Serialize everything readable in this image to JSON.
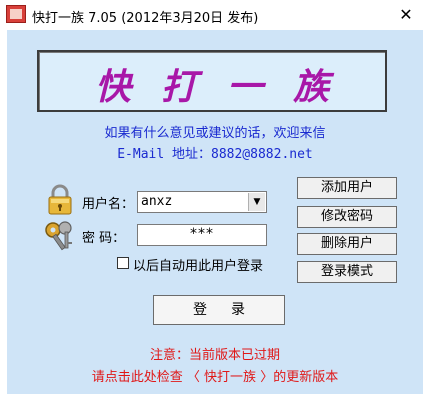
{
  "window": {
    "title": "快打一族 7.05 (2012年3月20日 发布)",
    "close_glyph": "✕"
  },
  "banner": {
    "text": "快打一族",
    "color": "#a817a8"
  },
  "info": {
    "line1": "如果有什么意见或建议的话，欢迎来信",
    "line2": "E-Mail 地址：8882@8882.net",
    "color": "#1a2ad0"
  },
  "form": {
    "username_label": "用户名：",
    "username_value": "anxz",
    "password_label": "密  码：",
    "password_value": "***",
    "auto_login_label": "以后自动用此用户登录",
    "auto_login_checked": false,
    "login_button": "登录"
  },
  "side_buttons": {
    "add_user": "添加用户",
    "change_password": "修改密码",
    "delete_user": "删除用户",
    "login_mode": "登录模式"
  },
  "notice": {
    "line1": "注意：当前版本已过期",
    "line2": "请点击此处检查 〈 快打一族 〉的更新版本",
    "color": "#e01818"
  },
  "icons": {
    "lock": "lock-icon",
    "key": "key-icon",
    "app": "app-icon"
  }
}
